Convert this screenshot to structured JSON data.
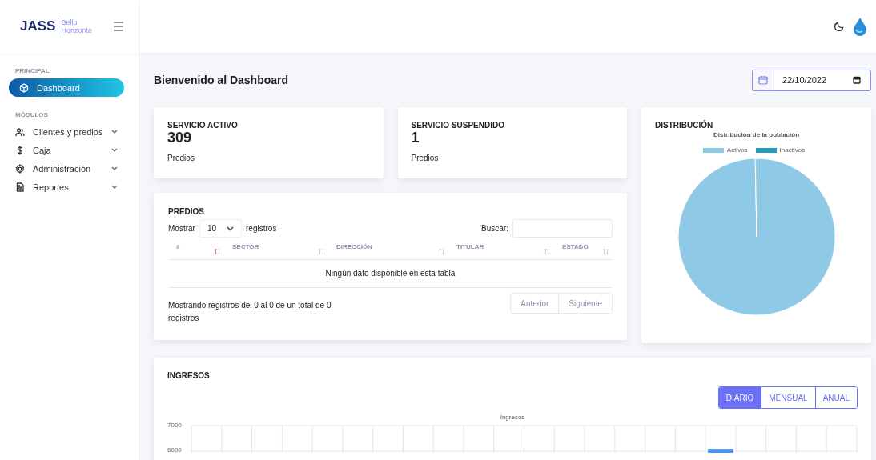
{
  "brand": {
    "name": "JASS",
    "subtitle_line1": "Bello",
    "subtitle_line2": "Horizonte"
  },
  "sidebar": {
    "sections": [
      {
        "title": "PRINCIPAL",
        "items": [
          {
            "label": "Dashboard",
            "selected": true,
            "has_children": false
          }
        ]
      },
      {
        "title": "MÓDULOS",
        "items": [
          {
            "label": "Clientes y predios",
            "selected": false,
            "has_children": true
          },
          {
            "label": "Caja",
            "selected": false,
            "has_children": true
          },
          {
            "label": "Administración",
            "selected": false,
            "has_children": true
          },
          {
            "label": "Reportes",
            "selected": false,
            "has_children": true
          }
        ]
      }
    ]
  },
  "page": {
    "title": "Bienvenido al Dashboard",
    "date": "22/10/2022"
  },
  "stats": [
    {
      "title": "SERVICIO ACTIVO",
      "value": "309",
      "unit": "Predios"
    },
    {
      "title": "SERVICIO SUSPENDIDO",
      "value": "1",
      "unit": "Predios"
    }
  ],
  "predios": {
    "title": "PREDIOS",
    "show_label": "Mostrar",
    "page_size": "10",
    "records_label": "registros",
    "search_label": "Buscar:",
    "columns": [
      {
        "label": "#",
        "sorted": true
      },
      {
        "label": "SECTOR",
        "sorted": false
      },
      {
        "label": "DIRECCIÓN",
        "sorted": false
      },
      {
        "label": "TITULAR",
        "sorted": false
      },
      {
        "label": "ESTADO",
        "sorted": false
      }
    ],
    "empty_message": "Ningún dato disponible en esta tabla",
    "info": "Mostrando registros del 0 al 0 de un total de 0 registros",
    "buttons": [
      "Anterior",
      "Siguiente"
    ]
  },
  "distribucion": {
    "title": "DISTRIBUCIÓN",
    "chart_data": {
      "type": "pie",
      "title": "Distribución de la población",
      "legend": "top",
      "categories": [
        "Activos",
        "Inactivos"
      ],
      "series": [
        {
          "colors": [
            "#8ecae6",
            "#219ebc"
          ],
          "values": [
            99.7,
            0.3
          ]
        }
      ]
    }
  },
  "ingresos": {
    "title": "INGRESOS",
    "periods": [
      {
        "label": "DIARIO",
        "selected": true
      },
      {
        "label": "MENSUAL",
        "selected": false
      },
      {
        "label": "ANUAL",
        "selected": false
      }
    ],
    "chart_data": {
      "type": "bar",
      "title": "Ingresos",
      "ylim": [
        5900,
        7000
      ],
      "yticks": [
        6000,
        7000
      ],
      "series": [
        {
          "color": "#4e8ff7",
          "values": [
            null,
            null,
            null,
            null,
            null,
            null,
            null,
            null,
            null,
            null,
            null,
            null,
            null,
            null,
            null,
            null,
            null,
            6090,
            null,
            null,
            null,
            null
          ]
        }
      ]
    }
  }
}
